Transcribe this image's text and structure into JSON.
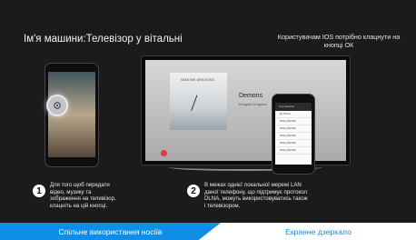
{
  "header": {
    "machine_name": "Ім'я машини:Телевізор у вітальні",
    "ios_hint": "Користувачам IOS потрібно клацнути на кнопці ОК"
  },
  "tv": {
    "album_text": "IMAGINE DRAGONS",
    "song_title": "Demons",
    "song_artist": "Imagine Dragons"
  },
  "phone_right": {
    "list_title": "Live Devices",
    "items": [
      "My Phone",
      "DLNA_DEVICE",
      "DLNA_DEVICE",
      "DLNA_DEVICE",
      "DLNA_DEVICE",
      "DLNA_DEVICE"
    ]
  },
  "steps": [
    {
      "number": "1",
      "text": "Для того щоб передати відео, музику та зображення на телевізор, клацніть на цій кнопці."
    },
    {
      "number": "2",
      "text": "В межах однієї локальної мережі LAN даної телефону, що підтримує протокол DLNA, можуть використовуватись також і телевізором."
    }
  ],
  "tabs": {
    "active_label": "Спільне використання носіїв",
    "inactive_label": "Екранне дзеркало"
  },
  "colors": {
    "accent": "#0e8ee6",
    "background": "#1b1b1b"
  }
}
